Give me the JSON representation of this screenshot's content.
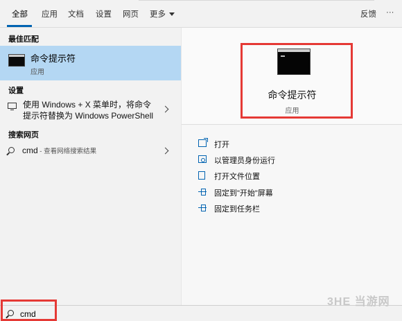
{
  "tabs": {
    "items": [
      "全部",
      "应用",
      "文档",
      "设置",
      "网页",
      "更多"
    ],
    "feedback": "反馈",
    "more_options": "···"
  },
  "left": {
    "best_match_title": "最佳匹配",
    "best_match_name": "命令提示符",
    "best_match_type": "应用",
    "settings_title": "设置",
    "settings_item": "使用 Windows + X 菜单时，将命令提示符替换为 Windows PowerShell",
    "web_title": "搜索网页",
    "web_query": "cmd",
    "web_hint": " - 查看网络搜索结果"
  },
  "preview": {
    "app_name": "命令提示符",
    "app_type": "应用"
  },
  "actions": [
    "打开",
    "以管理员身份运行",
    "打开文件位置",
    "固定到\"开始\"屏幕",
    "固定到任务栏"
  ],
  "search": {
    "value": "cmd"
  },
  "watermark": "3HE 当游网",
  "colors": {
    "accent": "#0063b1",
    "selection": "#b4d7f3",
    "highlight_box": "#e53935"
  }
}
